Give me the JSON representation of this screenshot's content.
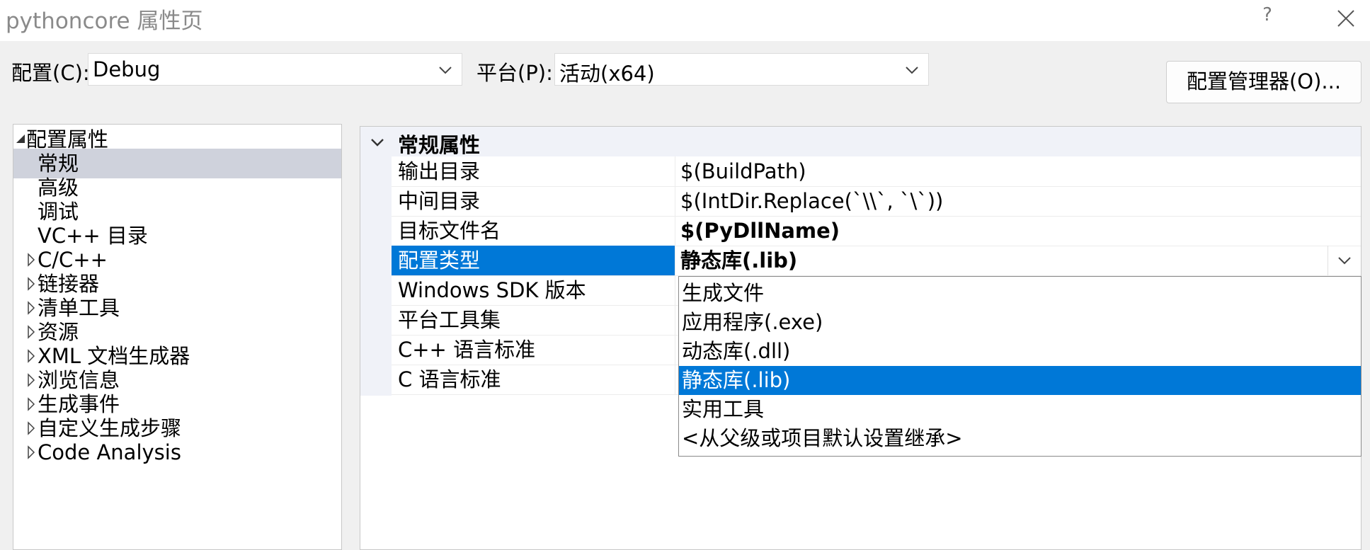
{
  "window": {
    "title": "pythoncore 属性页",
    "help_label": "?",
    "close_icon": "close-icon"
  },
  "config": {
    "config_label": "配置(C):",
    "config_value": "Debug",
    "platform_label": "平台(P):",
    "platform_value": "活动(x64)",
    "manager_button": "配置管理器(O)..."
  },
  "tree": {
    "root": "配置属性",
    "items": [
      {
        "label": "常规",
        "selected": true,
        "expandable": false
      },
      {
        "label": "高级",
        "selected": false,
        "expandable": false
      },
      {
        "label": "调试",
        "selected": false,
        "expandable": false
      },
      {
        "label": "VC++ 目录",
        "selected": false,
        "expandable": false
      },
      {
        "label": "C/C++",
        "selected": false,
        "expandable": true
      },
      {
        "label": "链接器",
        "selected": false,
        "expandable": true
      },
      {
        "label": "清单工具",
        "selected": false,
        "expandable": true
      },
      {
        "label": "资源",
        "selected": false,
        "expandable": true
      },
      {
        "label": "XML 文档生成器",
        "selected": false,
        "expandable": true
      },
      {
        "label": "浏览信息",
        "selected": false,
        "expandable": true
      },
      {
        "label": "生成事件",
        "selected": false,
        "expandable": true
      },
      {
        "label": "自定义生成步骤",
        "selected": false,
        "expandable": true
      },
      {
        "label": "Code Analysis",
        "selected": false,
        "expandable": true
      }
    ]
  },
  "grid": {
    "category": "常规属性",
    "rows": [
      {
        "name": "输出目录",
        "value": "$(BuildPath)",
        "bold": false
      },
      {
        "name": "中间目录",
        "value": "$(IntDir.Replace(`\\\\`, `\\`))",
        "bold": false
      },
      {
        "name": "目标文件名",
        "value": "$(PyDllName)",
        "bold": true
      },
      {
        "name": "配置类型",
        "value": "静态库(.lib)",
        "bold": true
      },
      {
        "name": "Windows SDK 版本",
        "value": "",
        "bold": false
      },
      {
        "name": "平台工具集",
        "value": "",
        "bold": false
      },
      {
        "name": "C++ 语言标准",
        "value": "",
        "bold": false
      },
      {
        "name": "C 语言标准",
        "value": "",
        "bold": false
      }
    ],
    "selected_row": 3
  },
  "dropdown": {
    "options": [
      "生成文件",
      "应用程序(.exe)",
      "动态库(.dll)",
      "静态库(.lib)",
      "实用工具",
      "<从父级或项目默认设置继承>"
    ],
    "selected_index": 3
  },
  "colors": {
    "selection": "#0078d7",
    "tree_selection": "#cfd2dc",
    "window_bg": "#f0f0f0"
  }
}
